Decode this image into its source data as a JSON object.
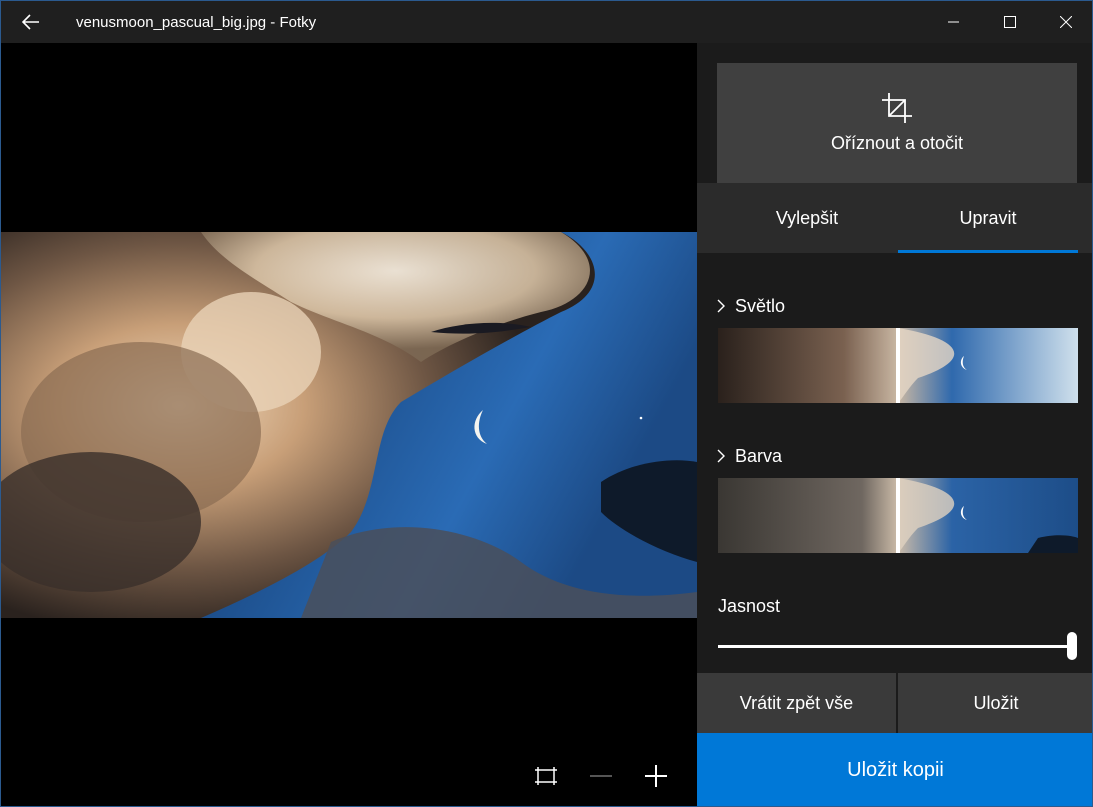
{
  "titlebar": {
    "title": "venusmoon_pascual_big.jpg - Fotky",
    "back_icon": "arrow-left-icon",
    "minimize_icon": "minimize-icon",
    "maximize_icon": "maximize-icon",
    "close_icon": "close-icon"
  },
  "viewer": {
    "zoom_icons": [
      "fit-to-window-icon",
      "zoom-out-icon",
      "zoom-in-icon"
    ]
  },
  "panel": {
    "crop_label": "Oříznout a otočit",
    "crop_icon": "crop-icon",
    "tabs": [
      {
        "label": "Vylepšit",
        "active": false
      },
      {
        "label": "Upravit",
        "active": true
      }
    ],
    "sections": [
      {
        "label": "Světlo"
      },
      {
        "label": "Barva"
      }
    ],
    "clarity": {
      "label": "Jasnost",
      "level_fraction": 1.0
    },
    "revert_label": "Vrátit zpět vše",
    "save_label": "Uložit",
    "save_copy_label": "Uložit kopii",
    "accent_color": "#0078d7"
  }
}
